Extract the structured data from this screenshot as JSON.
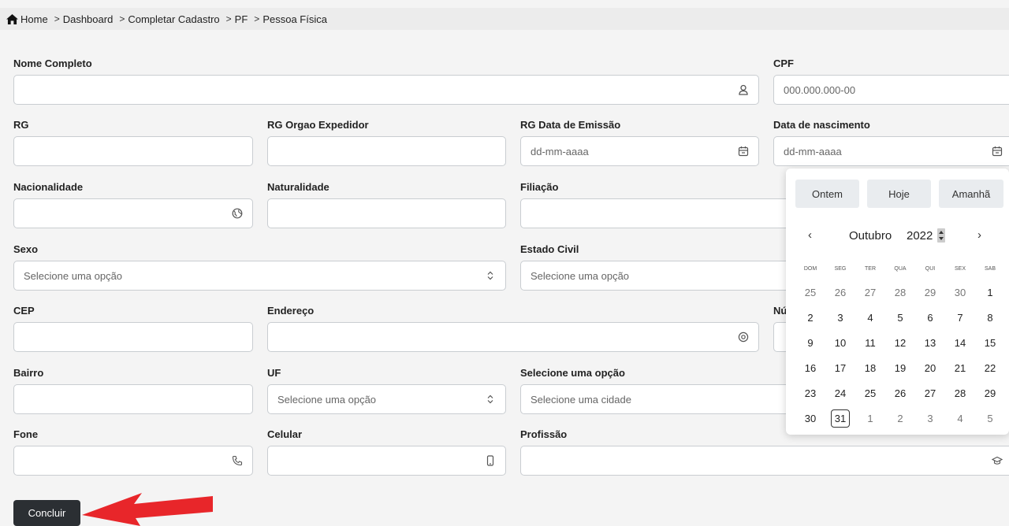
{
  "breadcrumb": [
    {
      "label": "Home"
    },
    {
      "label": "Dashboard"
    },
    {
      "label": "Completar Cadastro"
    },
    {
      "label": "PF"
    },
    {
      "label": "Pessoa Física"
    }
  ],
  "form": {
    "nome_completo": {
      "label": "Nome Completo",
      "value": ""
    },
    "cpf": {
      "label": "CPF",
      "placeholder": "000.000.000-00"
    },
    "rg": {
      "label": "RG",
      "value": ""
    },
    "rg_orgao": {
      "label": "RG Orgao Expedidor",
      "value": ""
    },
    "rg_data": {
      "label": "RG Data de Emissão",
      "placeholder": "dd-mm-aaaa"
    },
    "data_nascimento": {
      "label": "Data de nascimento",
      "placeholder": "dd-mm-aaaa"
    },
    "nacionalidade": {
      "label": "Nacionalidade",
      "value": ""
    },
    "naturalidade": {
      "label": "Naturalidade",
      "value": ""
    },
    "filiacao": {
      "label": "Filiação",
      "value": ""
    },
    "sexo": {
      "label": "Sexo",
      "placeholder": "Selecione uma opção"
    },
    "estado_civil": {
      "label": "Estado Civil",
      "placeholder": "Selecione uma opção"
    },
    "cep": {
      "label": "CEP",
      "value": ""
    },
    "endereco": {
      "label": "Endereço",
      "value": ""
    },
    "numero": {
      "label": "Nú",
      "value": ""
    },
    "bairro": {
      "label": "Bairro",
      "value": ""
    },
    "uf": {
      "label": "UF",
      "placeholder": "Selecione uma opção"
    },
    "cidade": {
      "label": "Selecione uma opção",
      "placeholder": "Selecione uma cidade"
    },
    "fone": {
      "label": "Fone",
      "value": ""
    },
    "celular": {
      "label": "Celular",
      "value": ""
    },
    "profissao": {
      "label": "Profissão",
      "value": ""
    }
  },
  "submit_label": "Concluir",
  "datepicker": {
    "quick": [
      "Ontem",
      "Hoje",
      "Amanhã"
    ],
    "prev": "‹",
    "next": "›",
    "month": "Outubro",
    "year": "2022",
    "weekdays": [
      "DOM",
      "SEG",
      "TER",
      "QUA",
      "QUI",
      "SEX",
      "SAB"
    ],
    "days": [
      [
        "25",
        "26",
        "27",
        "28",
        "29",
        "30",
        "1"
      ],
      [
        "2",
        "3",
        "4",
        "5",
        "6",
        "7",
        "8"
      ],
      [
        "9",
        "10",
        "11",
        "12",
        "13",
        "14",
        "15"
      ],
      [
        "16",
        "17",
        "18",
        "19",
        "20",
        "21",
        "22"
      ],
      [
        "23",
        "24",
        "25",
        "26",
        "27",
        "28",
        "29"
      ],
      [
        "30",
        "31",
        "1",
        "2",
        "3",
        "4",
        "5"
      ]
    ],
    "muted": [
      [
        0,
        0
      ],
      [
        0,
        1
      ],
      [
        0,
        2
      ],
      [
        0,
        3
      ],
      [
        0,
        4
      ],
      [
        0,
        5
      ],
      [
        5,
        2
      ],
      [
        5,
        3
      ],
      [
        5,
        4
      ],
      [
        5,
        5
      ],
      [
        5,
        6
      ]
    ],
    "today": [
      5,
      1
    ]
  },
  "colors": {
    "arrow": "#e8262a",
    "button": "#2b2f33"
  }
}
